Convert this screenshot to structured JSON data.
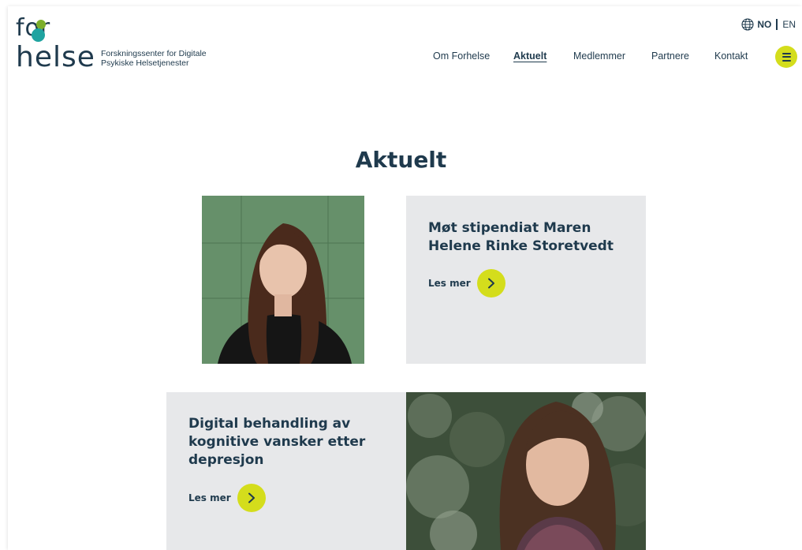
{
  "logo": {
    "line1": "for",
    "line2": "helse"
  },
  "tagline": {
    "line1": "Forskningssenter for Digitale",
    "line2": "Psykiske Helsetjenester"
  },
  "language": {
    "current": "NO",
    "other": "EN"
  },
  "nav": {
    "items": [
      {
        "label": "Om Forhelse"
      },
      {
        "label": "Aktuelt"
      },
      {
        "label": "Medlemmer"
      },
      {
        "label": "Partnere"
      },
      {
        "label": "Kontakt"
      }
    ]
  },
  "page": {
    "title": "Aktuelt"
  },
  "articles": [
    {
      "title_line1": "Møt stipendiat Maren",
      "title_line2": "Helene Rinke Storetvedt",
      "more": "Les mer"
    },
    {
      "title_line1": "Digital behandling av",
      "title_line2": "kognitive vansker etter",
      "title_line3": "depresjon",
      "more": "Les mer"
    }
  ],
  "colors": {
    "accent": "#d4dd1c",
    "text": "#1f3a4d",
    "card_bg": "#e7e8ea",
    "logo_teal": "#1fa3a0",
    "logo_green": "#7cae2b"
  }
}
